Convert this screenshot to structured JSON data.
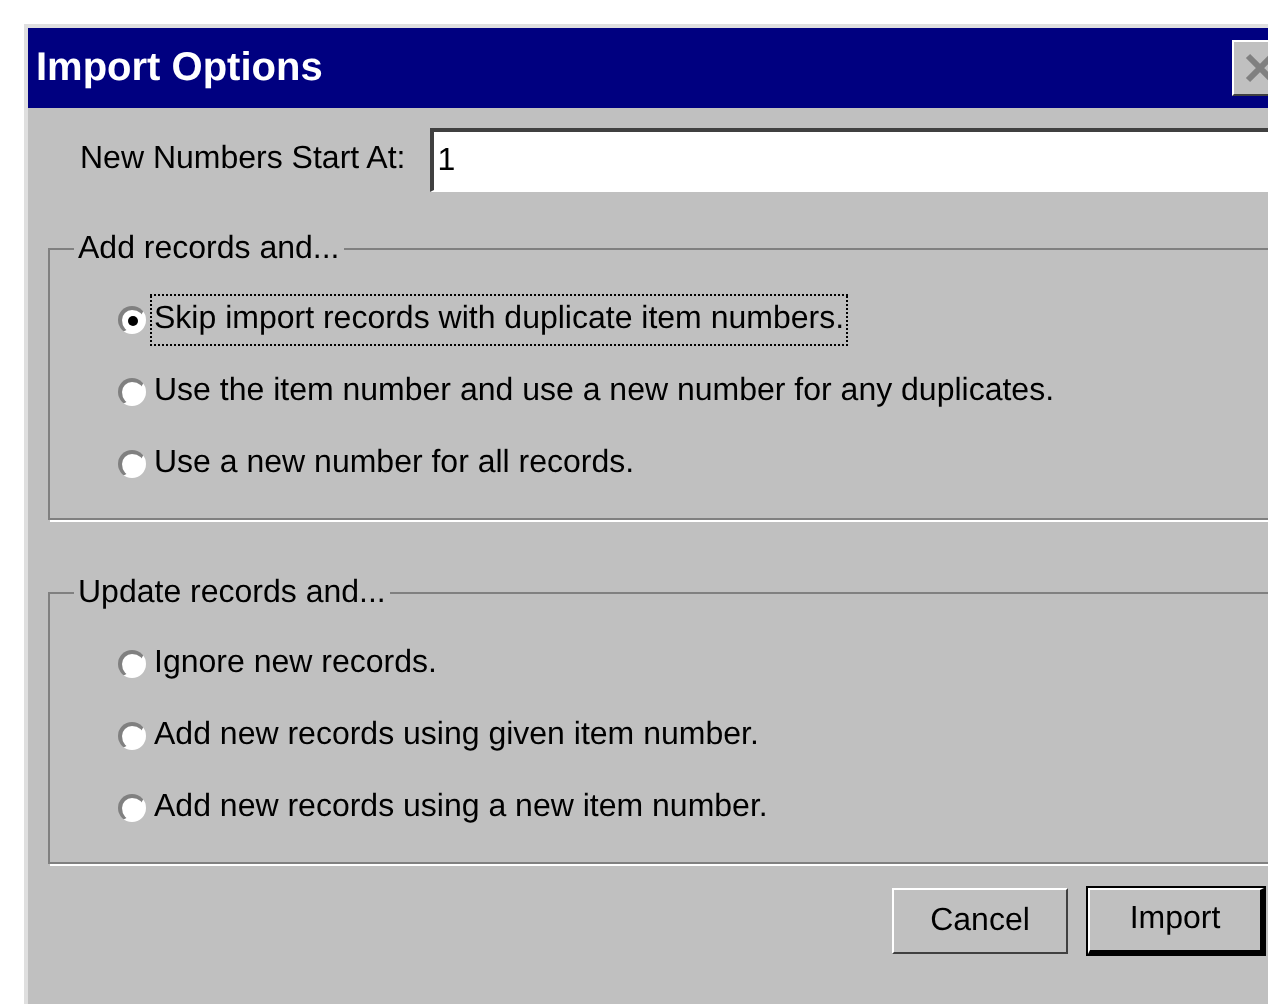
{
  "window": {
    "title": "Import Options"
  },
  "start_field": {
    "label": "New Numbers Start At:",
    "value": "1"
  },
  "groups": [
    {
      "title": "Add records and...",
      "options": [
        {
          "label": "Skip import records with duplicate item numbers.",
          "selected": true
        },
        {
          "label": "Use the item number and use a new number for any duplicates.",
          "selected": false
        },
        {
          "label": "Use a new number for all records.",
          "selected": false
        }
      ]
    },
    {
      "title": "Update records and...",
      "options": [
        {
          "label": "Ignore new records.",
          "selected": false
        },
        {
          "label": "Add new records using given item number.",
          "selected": false
        },
        {
          "label": "Add new records using a new item number.",
          "selected": false
        }
      ]
    }
  ],
  "buttons": [
    {
      "label": "Cancel",
      "default": false
    },
    {
      "label": "Import",
      "default": true
    }
  ]
}
